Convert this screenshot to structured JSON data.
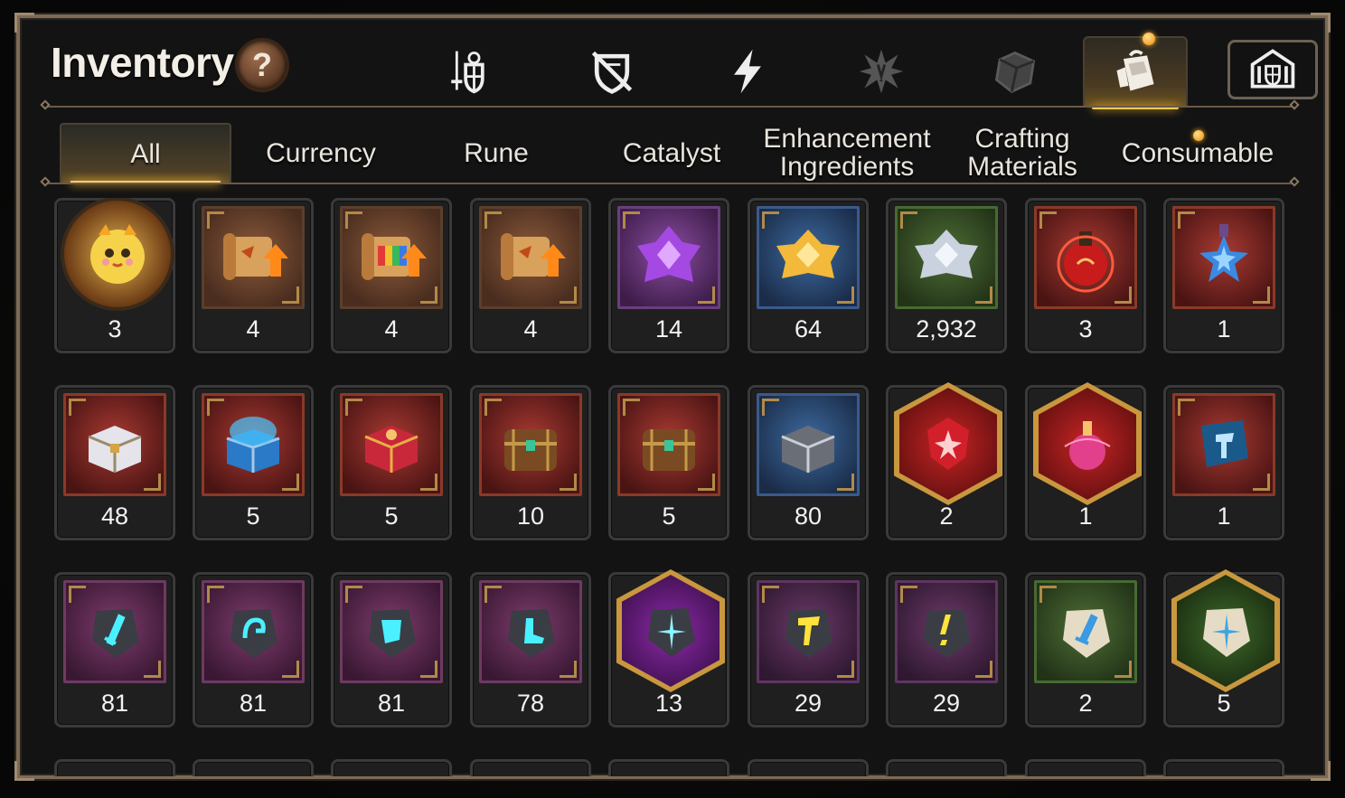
{
  "title": "Inventory",
  "help_label": "?",
  "category_tabs": [
    {
      "icon": "sword-shield-icon",
      "active": false
    },
    {
      "icon": "broken-shield-icon",
      "active": false
    },
    {
      "icon": "lightning-icon",
      "active": false
    },
    {
      "icon": "burst-icon",
      "active": false
    },
    {
      "icon": "cube-icon",
      "active": false
    },
    {
      "icon": "backpack-icon",
      "active": true,
      "notification": true
    },
    {
      "icon": "guild-shield-icon",
      "active": false
    }
  ],
  "sub_tabs": [
    "All",
    "Currency",
    "Rune",
    "Catalyst",
    "Enhancement Ingredients",
    "Crafting Materials",
    "Consumable"
  ],
  "sub_tabs_display": {
    "all": "All",
    "currency": "Currency",
    "rune": "Rune",
    "catalyst": "Catalyst",
    "enhancement_1": "Enhancement",
    "enhancement_2": "Ingredients",
    "crafting_1": "Crafting",
    "crafting_2": "Materials",
    "consumable": "Consumable"
  },
  "active_sub_tab": "All",
  "items": [
    {
      "icon": "mascot-coin-icon",
      "count": "3",
      "frame": "round"
    },
    {
      "icon": "scroll-upgrade-icon",
      "count": "4",
      "frame": "orange"
    },
    {
      "icon": "rainbow-scroll-upgrade-icon",
      "count": "4",
      "frame": "orange"
    },
    {
      "icon": "scroll-upgrade-icon",
      "count": "4",
      "frame": "orange"
    },
    {
      "icon": "purple-crystal-icon",
      "count": "14",
      "frame": "purple"
    },
    {
      "icon": "gold-crystal-icon",
      "count": "64",
      "frame": "blue"
    },
    {
      "icon": "silver-crystal-icon",
      "count": "2,932",
      "frame": "green"
    },
    {
      "icon": "red-potion-icon",
      "count": "3",
      "frame": "red"
    },
    {
      "icon": "blue-star-potion-icon",
      "count": "1",
      "frame": "red"
    },
    {
      "icon": "silver-chest-icon",
      "count": "48",
      "frame": "red"
    },
    {
      "icon": "blue-chest-icon",
      "count": "5",
      "frame": "red"
    },
    {
      "icon": "red-chest-icon",
      "count": "5",
      "frame": "red"
    },
    {
      "icon": "wooden-chest-icon",
      "count": "10",
      "frame": "red"
    },
    {
      "icon": "wooden-chest-icon",
      "count": "5",
      "frame": "red"
    },
    {
      "icon": "dark-chest-icon",
      "count": "80",
      "frame": "blue"
    },
    {
      "icon": "red-gem-icon",
      "count": "2",
      "frame": "hex-red"
    },
    {
      "icon": "pink-potion-icon",
      "count": "1",
      "frame": "hex-red"
    },
    {
      "icon": "hammer-stone-icon",
      "count": "1",
      "frame": "red"
    },
    {
      "icon": "sword-rune-icon",
      "count": "81",
      "frame": "mauve"
    },
    {
      "icon": "helm-rune-icon",
      "count": "81",
      "frame": "mauve"
    },
    {
      "icon": "armor-rune-icon",
      "count": "81",
      "frame": "mauve"
    },
    {
      "icon": "boot-rune-icon",
      "count": "78",
      "frame": "mauve"
    },
    {
      "icon": "star-rune-icon",
      "count": "13",
      "frame": "hex-purple"
    },
    {
      "icon": "gold-hammer-rune-icon",
      "count": "29",
      "frame": "plum"
    },
    {
      "icon": "gold-mark-rune-icon",
      "count": "29",
      "frame": "plum"
    },
    {
      "icon": "stone-sword-rune-icon",
      "count": "2",
      "frame": "green"
    },
    {
      "icon": "stone-star-rune-icon",
      "count": "5",
      "frame": "hex-green"
    }
  ],
  "colors": {
    "frame_border": "#7d6a55",
    "accent_gold": "#ffcc55",
    "text": "#f2f2f2"
  }
}
